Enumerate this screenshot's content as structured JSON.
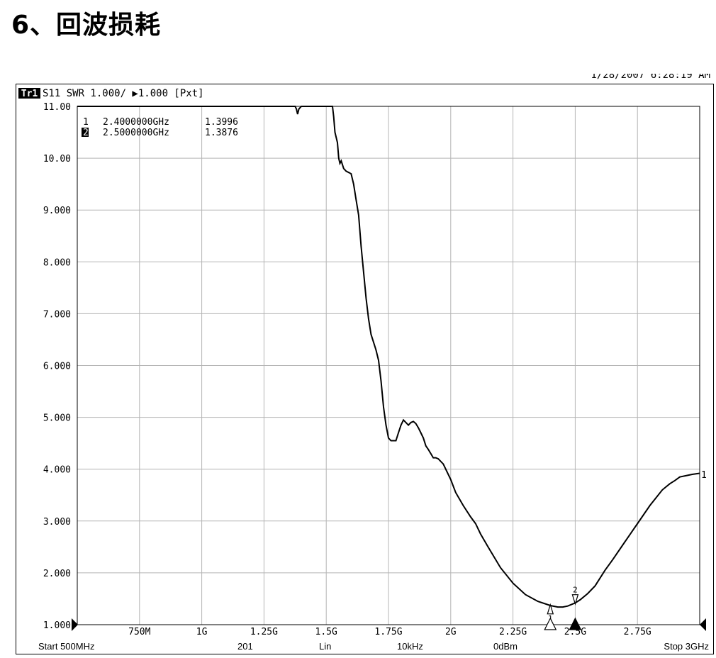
{
  "page": {
    "heading": "6、回波损耗"
  },
  "instrument": {
    "timestamp": "1/28/2007 6:28:19 AM",
    "trace_badge": "Tr1",
    "trace_spec": "S11 SWR 1.000/ ▶1.000 [Pxt]",
    "markers": [
      {
        "id": "1",
        "freq": "2.4000000GHz",
        "value": "1.3996"
      },
      {
        "id": "2",
        "freq": "2.5000000GHz",
        "value": "1.3876"
      }
    ],
    "trace_end_label": "1",
    "footer": {
      "start": "Start 500MHz",
      "points": "201",
      "scale": "Lin",
      "ifbw": "10kHz",
      "power": "0dBm",
      "stop": "Stop 3GHz"
    }
  },
  "chart_data": {
    "type": "line",
    "title": "",
    "xlabel": "",
    "ylabel": "",
    "xlim": [
      0.5,
      3.0
    ],
    "ylim": [
      1.0,
      11.0
    ],
    "grid": true,
    "y_ticks": [
      {
        "v": 11,
        "label": "11.00"
      },
      {
        "v": 10,
        "label": "10.00"
      },
      {
        "v": 9,
        "label": "9.000"
      },
      {
        "v": 8,
        "label": "8.000"
      },
      {
        "v": 7,
        "label": "7.000"
      },
      {
        "v": 6,
        "label": "6.000"
      },
      {
        "v": 5,
        "label": "5.000"
      },
      {
        "v": 4,
        "label": "4.000"
      },
      {
        "v": 3,
        "label": "3.000"
      },
      {
        "v": 2,
        "label": "2.000"
      },
      {
        "v": 1,
        "label": "1.000"
      }
    ],
    "x_ticks": [
      {
        "v": 0.75,
        "label": "750M"
      },
      {
        "v": 1.0,
        "label": "1G"
      },
      {
        "v": 1.25,
        "label": "1.25G"
      },
      {
        "v": 1.5,
        "label": "1.5G"
      },
      {
        "v": 1.75,
        "label": "1.75G"
      },
      {
        "v": 2.0,
        "label": "2G"
      },
      {
        "v": 2.25,
        "label": "2.25G"
      },
      {
        "v": 2.5,
        "label": "2.5G"
      },
      {
        "v": 2.75,
        "label": "2.75G"
      }
    ],
    "series": [
      {
        "color": "#000000",
        "x": [
          0.5,
          1.3,
          1.375,
          1.38,
          1.385,
          1.39,
          1.4,
          1.5,
          1.525,
          1.53,
          1.535,
          1.545,
          1.55,
          1.555,
          1.56,
          1.57,
          1.58,
          1.6,
          1.61,
          1.62,
          1.63,
          1.64,
          1.65,
          1.66,
          1.67,
          1.68,
          1.69,
          1.7,
          1.71,
          1.72,
          1.73,
          1.74,
          1.75,
          1.76,
          1.77,
          1.78,
          1.79,
          1.8,
          1.81,
          1.82,
          1.83,
          1.84,
          1.85,
          1.86,
          1.87,
          1.88,
          1.89,
          1.9,
          1.91,
          1.92,
          1.93,
          1.94,
          1.95,
          1.97,
          2.0,
          2.02,
          2.05,
          2.08,
          2.1,
          2.12,
          2.15,
          2.2,
          2.25,
          2.3,
          2.35,
          2.4,
          2.43,
          2.45,
          2.47,
          2.5,
          2.52,
          2.55,
          2.58,
          2.6,
          2.62,
          2.65,
          2.7,
          2.75,
          2.8,
          2.85,
          2.88,
          2.9,
          2.92,
          2.95,
          2.97,
          3.0
        ],
        "y": [
          11.0,
          11.0,
          11.0,
          10.95,
          10.85,
          10.95,
          11.0,
          11.0,
          11.0,
          10.8,
          10.5,
          10.3,
          10.0,
          9.9,
          9.95,
          9.8,
          9.75,
          9.7,
          9.5,
          9.2,
          8.9,
          8.3,
          7.8,
          7.3,
          6.9,
          6.6,
          6.45,
          6.3,
          6.1,
          5.7,
          5.2,
          4.85,
          4.6,
          4.55,
          4.55,
          4.55,
          4.7,
          4.85,
          4.95,
          4.9,
          4.85,
          4.9,
          4.92,
          4.88,
          4.8,
          4.7,
          4.6,
          4.45,
          4.38,
          4.3,
          4.22,
          4.22,
          4.2,
          4.1,
          3.8,
          3.55,
          3.3,
          3.08,
          2.95,
          2.75,
          2.5,
          2.1,
          1.8,
          1.58,
          1.45,
          1.37,
          1.34,
          1.34,
          1.36,
          1.42,
          1.48,
          1.6,
          1.75,
          1.9,
          2.05,
          2.25,
          2.6,
          2.95,
          3.3,
          3.6,
          3.72,
          3.78,
          3.85,
          3.88,
          3.9,
          3.92
        ]
      }
    ],
    "markers": [
      {
        "id": "1",
        "x": 2.4,
        "y": 1.3996
      },
      {
        "id": "2",
        "x": 2.5,
        "y": 1.3876
      }
    ]
  }
}
